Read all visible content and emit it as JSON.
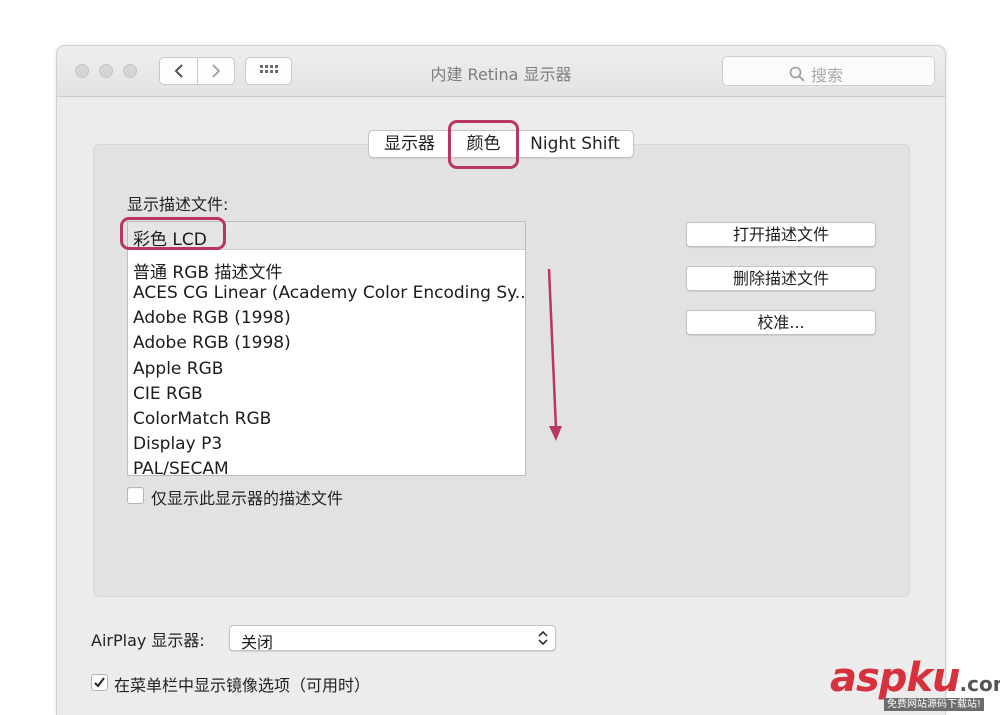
{
  "window": {
    "title": "内建 Retina 显示器"
  },
  "search": {
    "placeholder": "搜索",
    "icon": "search-icon"
  },
  "tabs": [
    {
      "label": "显示器"
    },
    {
      "label": "颜色",
      "selected": true
    },
    {
      "label": "Night Shift"
    }
  ],
  "profiles": {
    "label": "显示描述文件:",
    "selected": "彩色 LCD",
    "items": [
      "普通 RGB 描述文件",
      "ACES CG Linear (Academy Color Encoding Sy...",
      "Adobe RGB (1998)",
      "Adobe RGB (1998)",
      "Apple RGB",
      "CIE RGB",
      "ColorMatch RGB",
      "Display P3",
      "PAL/SECAM"
    ],
    "only_this_display_label": "仅显示此显示器的描述文件",
    "only_this_display_checked": false
  },
  "buttons": {
    "open": "打开描述文件",
    "delete": "删除描述文件",
    "calibrate": "校准..."
  },
  "airplay": {
    "label": "AirPlay 显示器:",
    "value": "关闭"
  },
  "mirroring": {
    "label": "在菜单栏中显示镜像选项（可用时）",
    "checked": true
  },
  "annotation_color": "#b8365f",
  "watermark": {
    "brand": "aspku",
    "tld": ".com",
    "tagline": "免费网站源码下载站!"
  }
}
